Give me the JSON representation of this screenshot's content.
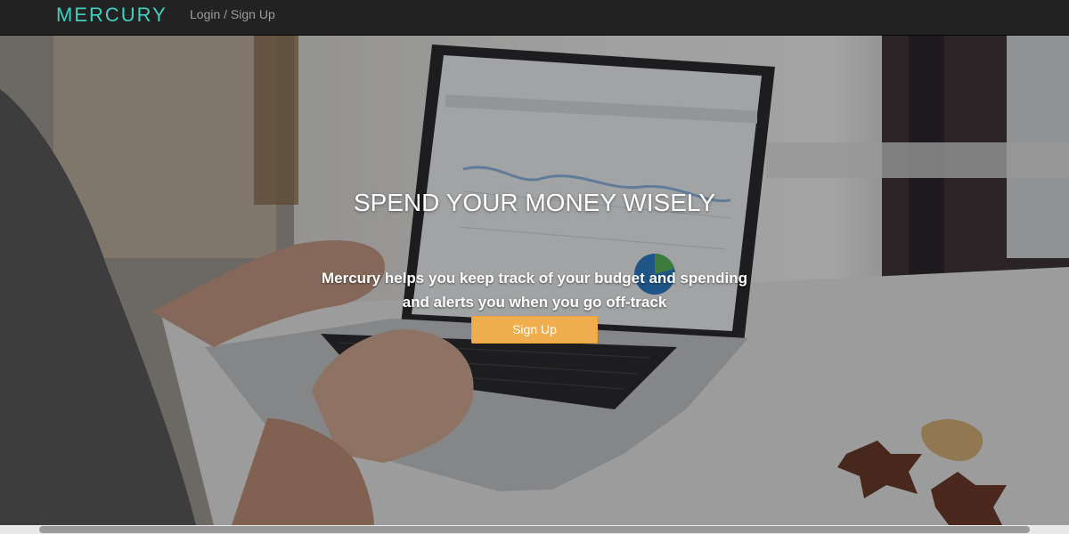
{
  "navbar": {
    "brand": "MERCURY",
    "login_link": "Login / Sign Up"
  },
  "hero": {
    "headline": "SPEND YOUR MONEY WISELY",
    "subline_1": "Mercury helps you keep track of your budget and spending",
    "subline_2": "and alerts you when you go off-track",
    "cta_label": "Sign Up"
  },
  "colors": {
    "brand": "#3fd1c0",
    "navbar_bg": "#222222",
    "nav_link": "#9d9d9d",
    "cta_bg": "#f0ad4e"
  },
  "icons": [
    "laptop-photo"
  ]
}
